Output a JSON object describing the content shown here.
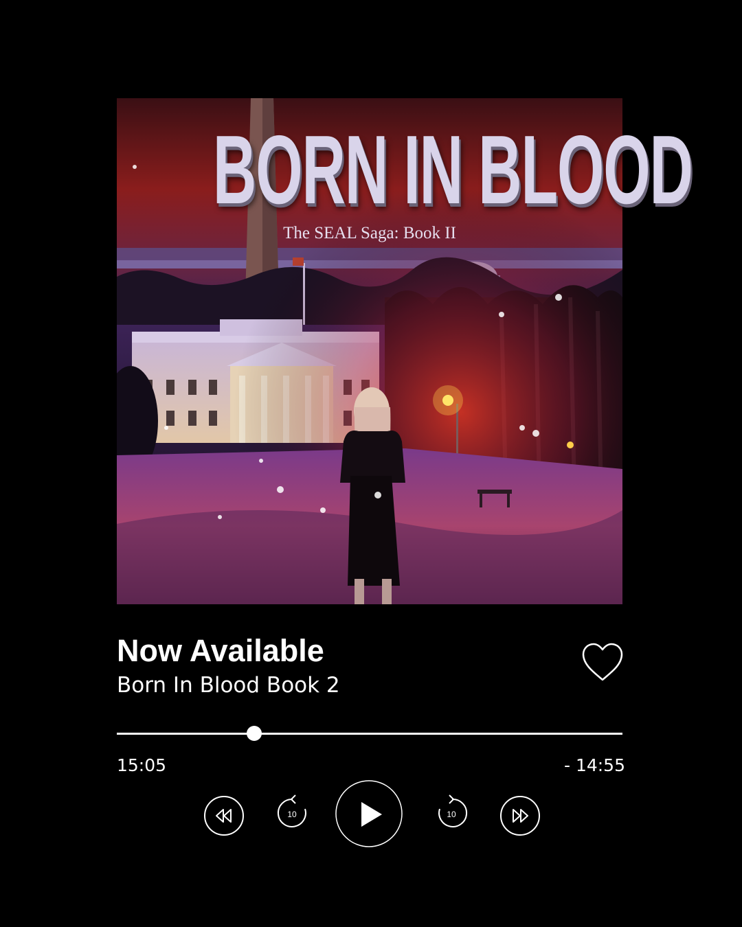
{
  "cover": {
    "title": "BORN IN BLOOD",
    "subtitle": "The SEAL Saga: Book II"
  },
  "track": {
    "title": "Now Available",
    "subtitle": "Born In Blood Book 2"
  },
  "playback": {
    "elapsed": "15:05",
    "remaining": "- 14:55",
    "progress_fraction": 0.272
  },
  "controls": {
    "rewind_icon": "rewind-icon",
    "skip_back_icon": "replay-10-icon",
    "skip_back_label": "10",
    "play_icon": "play-icon",
    "skip_forward_icon": "forward-10-icon",
    "skip_forward_label": "10",
    "fast_forward_icon": "fast-forward-icon",
    "favorite_icon": "heart-icon"
  },
  "colors": {
    "background": "#000000",
    "foreground": "#ffffff"
  }
}
